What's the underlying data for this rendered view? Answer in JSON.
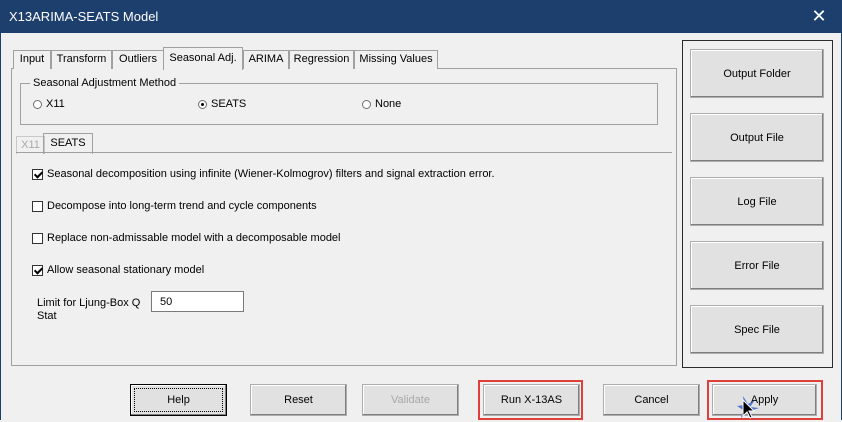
{
  "window": {
    "title": "X13ARIMA-SEATS Model",
    "close_glyph": "✕"
  },
  "tabs": [
    {
      "label": "Input",
      "active": false
    },
    {
      "label": "Transform",
      "active": false
    },
    {
      "label": "Outliers",
      "active": false
    },
    {
      "label": "Seasonal Adj.",
      "active": true
    },
    {
      "label": "ARIMA",
      "active": false
    },
    {
      "label": "Regression",
      "active": false
    },
    {
      "label": "Missing Values",
      "active": false
    }
  ],
  "method_group": {
    "legend": "Seasonal Adjustment Method",
    "options": [
      {
        "label": "X11",
        "selected": false
      },
      {
        "label": "SEATS",
        "selected": true
      },
      {
        "label": "None",
        "selected": false
      }
    ]
  },
  "inner_tabs": [
    {
      "label": "X11",
      "enabled": false
    },
    {
      "label": "SEATS",
      "enabled": true,
      "active": true
    }
  ],
  "options": [
    {
      "label": "Seasonal decomposition using infinite (Wiener-Kolmogrov) filters and signal extraction error.",
      "checked": true
    },
    {
      "label": "Decompose into long-term trend and cycle  components",
      "checked": false
    },
    {
      "label": "Replace non-admissable model with a decomposable model",
      "checked": false
    },
    {
      "label": "Allow seasonal stationary model",
      "checked": true
    }
  ],
  "ljung_box": {
    "label": "Limit for Ljung-Box Q Stat",
    "value": "50"
  },
  "side_buttons": [
    "Output Folder",
    "Output File",
    "Log File",
    "Error File",
    "Spec File"
  ],
  "bottom_buttons": {
    "help": "Help",
    "reset": "Reset",
    "validate": "Validate",
    "run": "Run X-13AS",
    "cancel": "Cancel",
    "apply": "Apply"
  },
  "colors": {
    "titlebar": "#1d3f6e",
    "highlight": "#e0403a",
    "face": "#f0f0f0",
    "button": "#e1e1e1"
  }
}
